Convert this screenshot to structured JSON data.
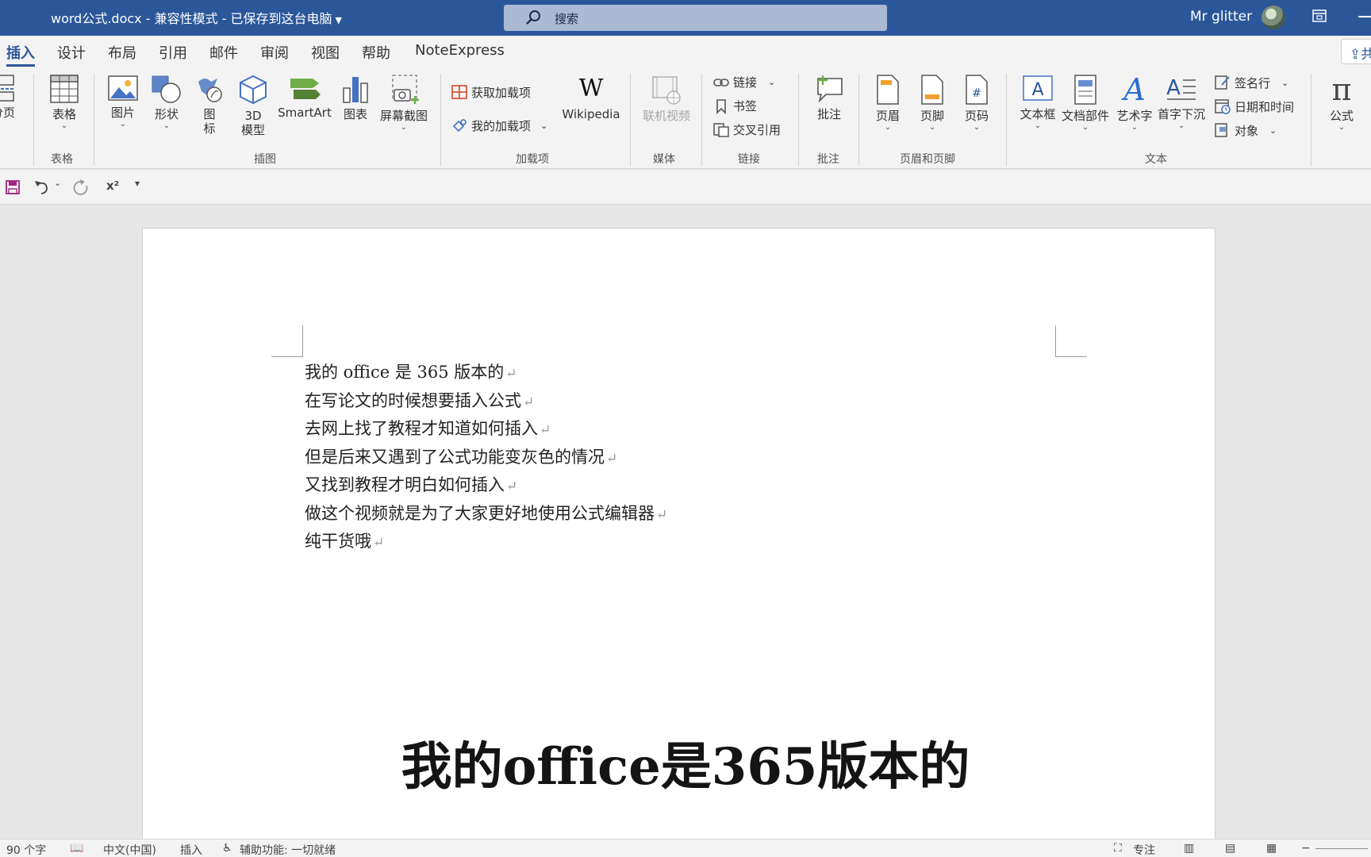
{
  "title_bar": {
    "document_title": "word公式.docx  -  兼容性模式  -  已保存到这台电脑",
    "search_placeholder": "搜索",
    "user_name": "Mr glitter"
  },
  "ribbon_tabs": [
    "插入",
    "设计",
    "布局",
    "引用",
    "邮件",
    "审阅",
    "视图",
    "帮助",
    "NoteExpress"
  ],
  "active_tab": "插入",
  "share_label": "共",
  "ribbon": {
    "pages_label": "分页",
    "table": {
      "label": "表格",
      "group": "表格"
    },
    "illustrations": {
      "group": "插图",
      "picture": "图片",
      "shapes": "形状",
      "icons_1": "图",
      "icons_2": "标",
      "model_1": "3D",
      "model_2": "模型",
      "smartart": "SmartArt",
      "chart": "图表",
      "screenshot": "屏幕截图"
    },
    "addins": {
      "group": "加载项",
      "get_addins": "获取加载项",
      "my_addins": "我的加载项",
      "wikipedia": "Wikipedia"
    },
    "media": {
      "group": "媒体",
      "online_video": "联机视频"
    },
    "links": {
      "group": "链接",
      "link": "链接",
      "bookmark": "书签",
      "cross_ref": "交叉引用"
    },
    "comments": {
      "group": "批注",
      "comment": "批注"
    },
    "header_footer": {
      "group": "页眉和页脚",
      "header": "页眉",
      "footer": "页脚",
      "page_number": "页码"
    },
    "text": {
      "group": "文本",
      "textbox": "文本框",
      "quick_parts": "文档部件",
      "wordart": "艺术字",
      "dropcap": "首字下沉",
      "signature": "签名行",
      "datetime": "日期和时间",
      "object": "对象"
    },
    "equation": {
      "label": "公式"
    }
  },
  "qat": {
    "superscript": "x²"
  },
  "document": {
    "lines": [
      "我的 office 是 365 版本的",
      "在写论文的时候想要插入公式",
      "去网上找了教程才知道如何插入",
      "但是后来又遇到了公式功能变灰色的情况",
      "又找到教程才明白如何插入",
      "做这个视频就是为了大家更好地使用公式编辑器",
      "纯干货哦"
    ],
    "paragraph_mark": "↵"
  },
  "caption": "我的office是365版本的",
  "status_bar": {
    "word_count": "90 个字",
    "language": "中文(中国)",
    "insert_mode": "插入",
    "accessibility": "辅助功能: 一切就绪",
    "focus": "专注"
  },
  "colors": {
    "title_bar": "#2b579a",
    "accent": "#2b579a",
    "ribbon_bg": "#f3f3f3"
  }
}
